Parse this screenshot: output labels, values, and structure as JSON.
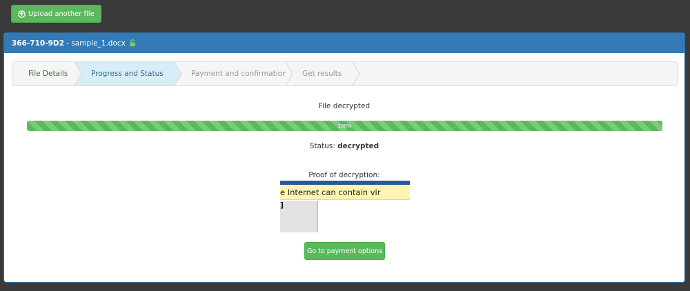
{
  "toolbar": {
    "upload_label": "Upload another file"
  },
  "panel": {
    "file_id": "366-710-9D2",
    "separator": " - ",
    "file_name": "sample_1.docx",
    "lock_icon": "unlocked-lock-icon"
  },
  "steps": [
    {
      "label": "File Details",
      "state": "complete"
    },
    {
      "label": "Progress and Status",
      "state": "active"
    },
    {
      "label": "Payment and confirmation",
      "state": "pending"
    },
    {
      "label": "Get results",
      "state": "pending"
    }
  ],
  "main": {
    "status_title": "File decrypted",
    "progress_label": "100%",
    "progress_value": 100,
    "status_prefix": "Status: ",
    "status_value": "decrypted",
    "proof_title": "Proof of decryption:",
    "proof_text": "e Internet can contain vir",
    "proof_mark": "]",
    "pay_button": "Go to payment options"
  },
  "colors": {
    "background": "#3a3a3a",
    "primary": "#337ab7",
    "success": "#5cb85c",
    "active_step": "#d9edf7"
  }
}
